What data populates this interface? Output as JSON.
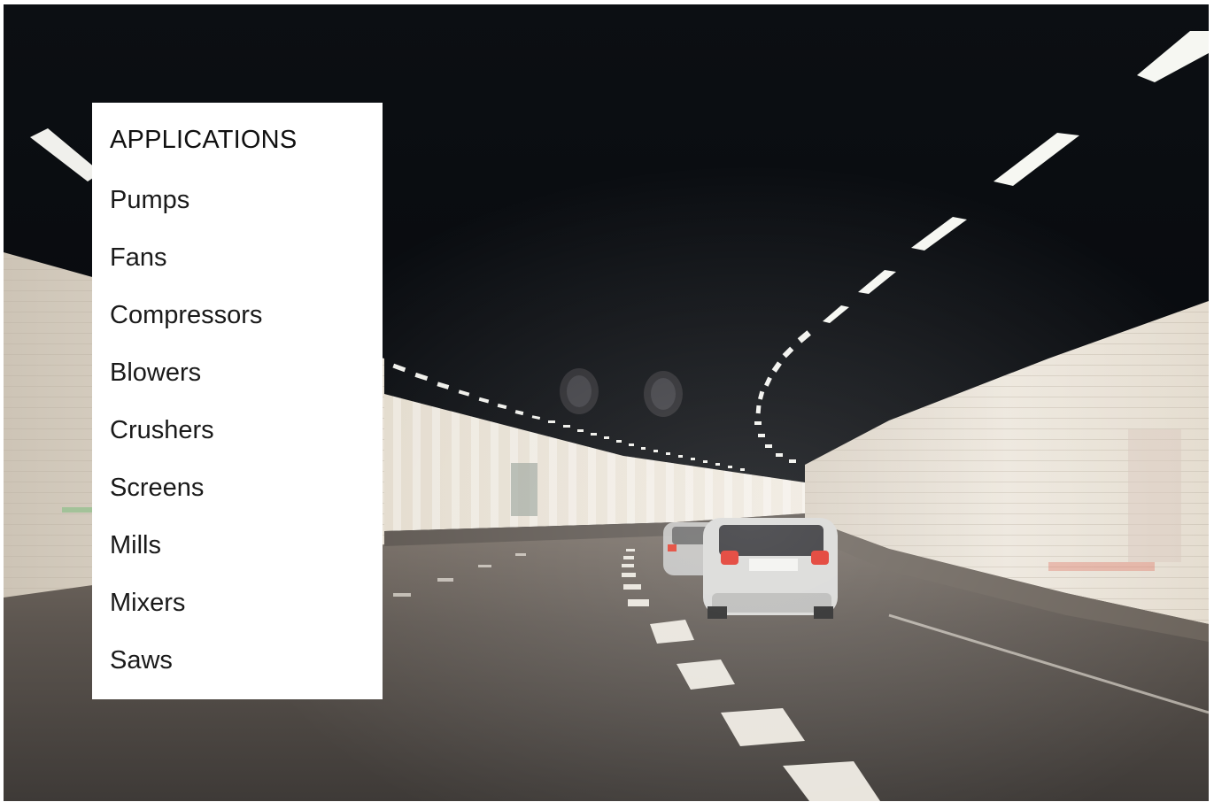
{
  "panel": {
    "title": "APPLICATIONS",
    "items": [
      {
        "label": "Pumps"
      },
      {
        "label": "Fans"
      },
      {
        "label": "Compressors"
      },
      {
        "label": "Blowers"
      },
      {
        "label": "Crushers"
      },
      {
        "label": "Screens"
      },
      {
        "label": "Mills"
      },
      {
        "label": "Mixers"
      },
      {
        "label": "Saws"
      }
    ]
  },
  "colors": {
    "panel_background": "#ffffff",
    "panel_text": "#111111",
    "tunnel_ceiling": "#070a0e",
    "tunnel_wall": "#e9e2d6",
    "road": "#5c5650"
  }
}
